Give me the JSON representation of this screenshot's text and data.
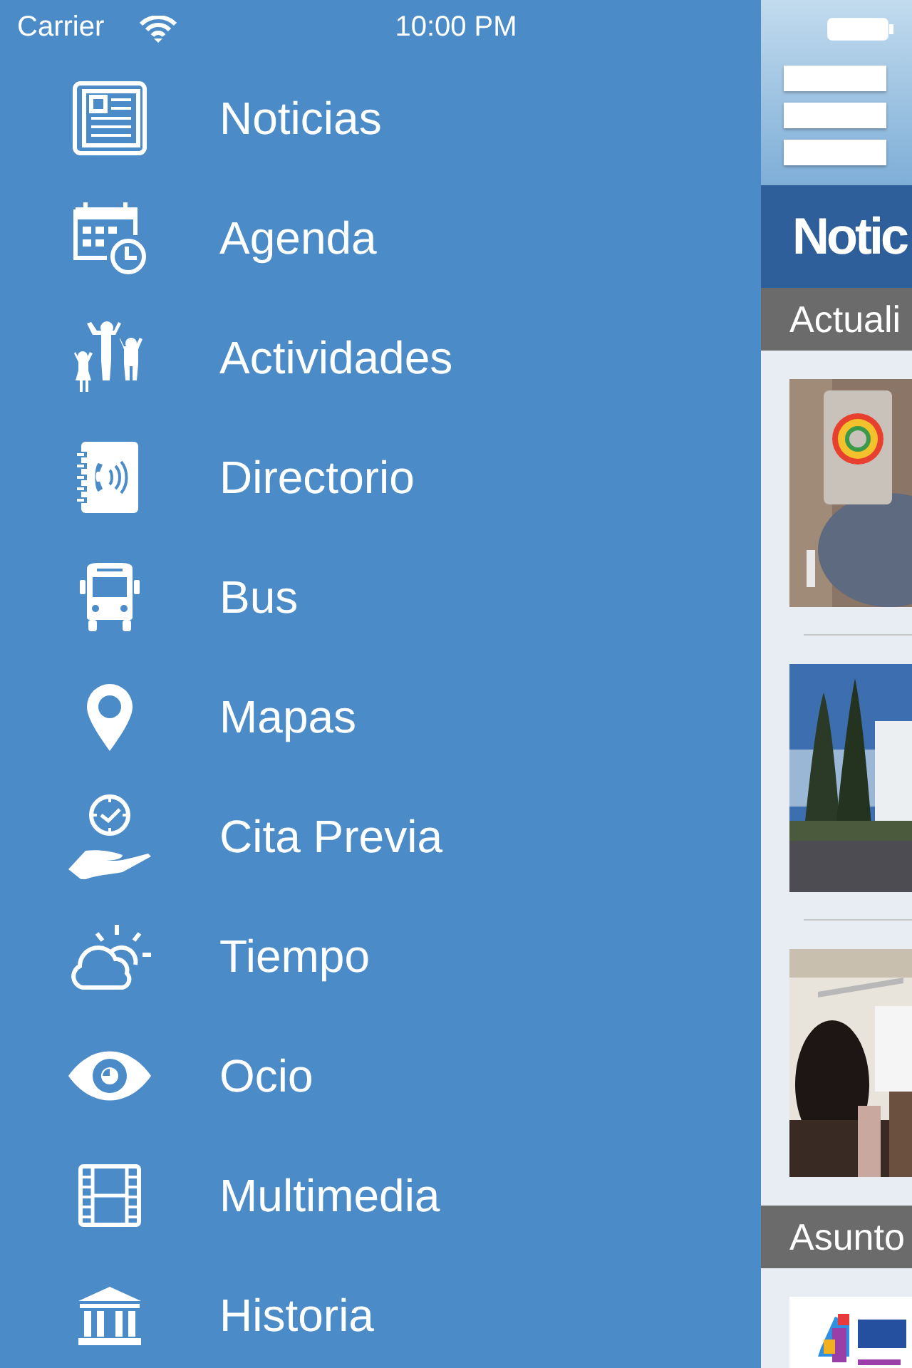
{
  "status_bar": {
    "carrier": "Carrier",
    "time": "10:00 PM"
  },
  "menu": {
    "items": [
      {
        "label": "Noticias"
      },
      {
        "label": "Agenda"
      },
      {
        "label": "Actividades"
      },
      {
        "label": "Directorio"
      },
      {
        "label": "Bus"
      },
      {
        "label": "Mapas"
      },
      {
        "label": "Cita Previa"
      },
      {
        "label": "Tiempo"
      },
      {
        "label": "Ocio"
      },
      {
        "label": "Multimedia"
      },
      {
        "label": "Historia"
      }
    ]
  },
  "news_panel": {
    "title": "Notic",
    "sections": [
      {
        "heading": "Actuali"
      },
      {
        "heading": "Asunto"
      }
    ]
  }
}
